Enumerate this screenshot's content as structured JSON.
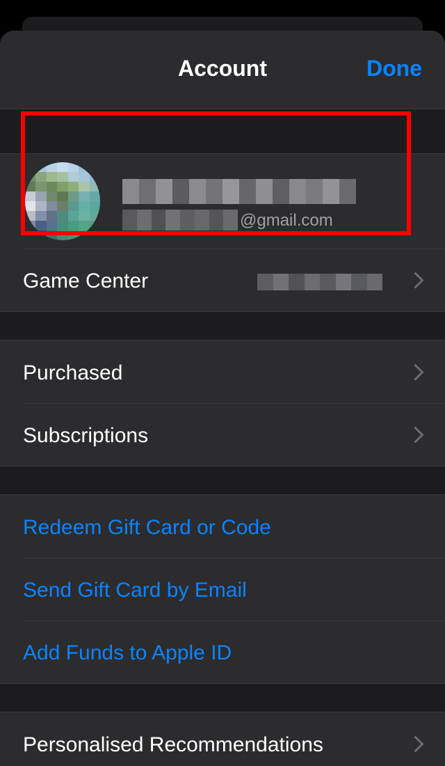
{
  "nav": {
    "title": "Account",
    "done_label": "Done"
  },
  "profile": {
    "email_domain": "@gmail.com"
  },
  "group1": {
    "items": [
      {
        "label": "Game Center"
      }
    ]
  },
  "group2": {
    "items": [
      {
        "label": "Purchased"
      },
      {
        "label": "Subscriptions"
      }
    ]
  },
  "group3": {
    "items": [
      {
        "label": "Redeem Gift Card or Code"
      },
      {
        "label": "Send Gift Card by Email"
      },
      {
        "label": "Add Funds to Apple ID"
      }
    ]
  },
  "group4": {
    "items": [
      {
        "label": "Personalised Recommendations"
      }
    ]
  },
  "icons": {
    "chevron": "chevron-right-icon"
  },
  "colors": {
    "accent": "#0a84ff",
    "highlight": "#ff0000",
    "background": "#1c1c1e",
    "cell": "#2c2c2e"
  }
}
